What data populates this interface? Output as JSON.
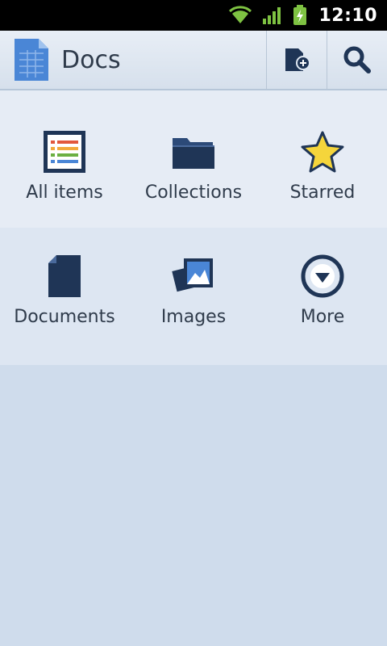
{
  "status_bar": {
    "time": "12:10",
    "icons": [
      "wifi-icon",
      "signal-icon",
      "battery-charging-icon"
    ]
  },
  "app_bar": {
    "title": "Docs",
    "logo_icon": "docs-logo-icon",
    "actions": [
      "new-doc-icon",
      "search-icon"
    ]
  },
  "grid": {
    "row1": [
      {
        "label": "All items",
        "icon": "list-icon"
      },
      {
        "label": "Collections",
        "icon": "folder-icon"
      },
      {
        "label": "Starred",
        "icon": "star-icon"
      }
    ],
    "row2": [
      {
        "label": "Documents",
        "icon": "document-icon"
      },
      {
        "label": "Images",
        "icon": "images-icon"
      },
      {
        "label": "More",
        "icon": "more-icon"
      }
    ]
  },
  "colors": {
    "accent": "#1f3556",
    "star": "#f5d53b",
    "background": "#cfdcec"
  }
}
